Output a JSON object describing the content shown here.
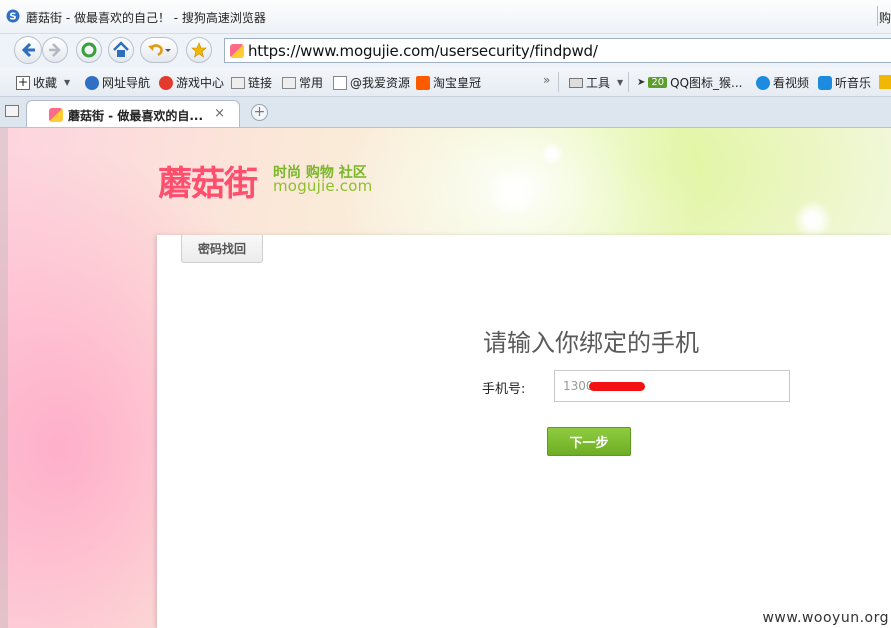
{
  "window": {
    "title": "蘑菇街 - 做最喜欢的自己！ - 搜狗高速浏览器",
    "right_edge_text": "购"
  },
  "navbar": {
    "url": "https://www.mogujie.com/usersecurity/findpwd/"
  },
  "bookmarks": [
    {
      "label": "收藏",
      "icon": "plus-icon"
    },
    {
      "label": "网址导航",
      "icon": "sogou-icon"
    },
    {
      "label": "游戏中心",
      "icon": "game-icon"
    },
    {
      "label": "链接",
      "icon": "folder-icon"
    },
    {
      "label": "常用",
      "icon": "folder-icon"
    },
    {
      "label": "@我爱资源",
      "icon": "page-icon"
    },
    {
      "label": "淘宝皇冠",
      "icon": "taobao-icon"
    },
    {
      "label": "工具",
      "icon": "tools-icon"
    },
    {
      "label": "QQ图标_猴...",
      "icon": "qq-icon",
      "badge": "20"
    },
    {
      "label": "看视频",
      "icon": "video-icon"
    },
    {
      "label": "听音乐",
      "icon": "music-icon"
    }
  ],
  "tabs": [
    {
      "label": "蘑菇街 - 做最喜欢的自...",
      "close": "×",
      "active": true
    }
  ],
  "newtab_symbol": "+",
  "page": {
    "logo_cn": "蘑菇街",
    "logo_slogan": "时尚 购物 社区",
    "logo_domain": "mogujie.com",
    "card_tab": "密码找回",
    "heading": "请输入你绑定的手机",
    "phone_label": "手机号:",
    "phone_value": "1300",
    "next_button": "下一步",
    "watermark": "www.wooyun.org"
  },
  "colors": {
    "brand_pink": "#ff4f6d",
    "brand_green": "#7ab52a",
    "button_green": "#6eae25"
  }
}
